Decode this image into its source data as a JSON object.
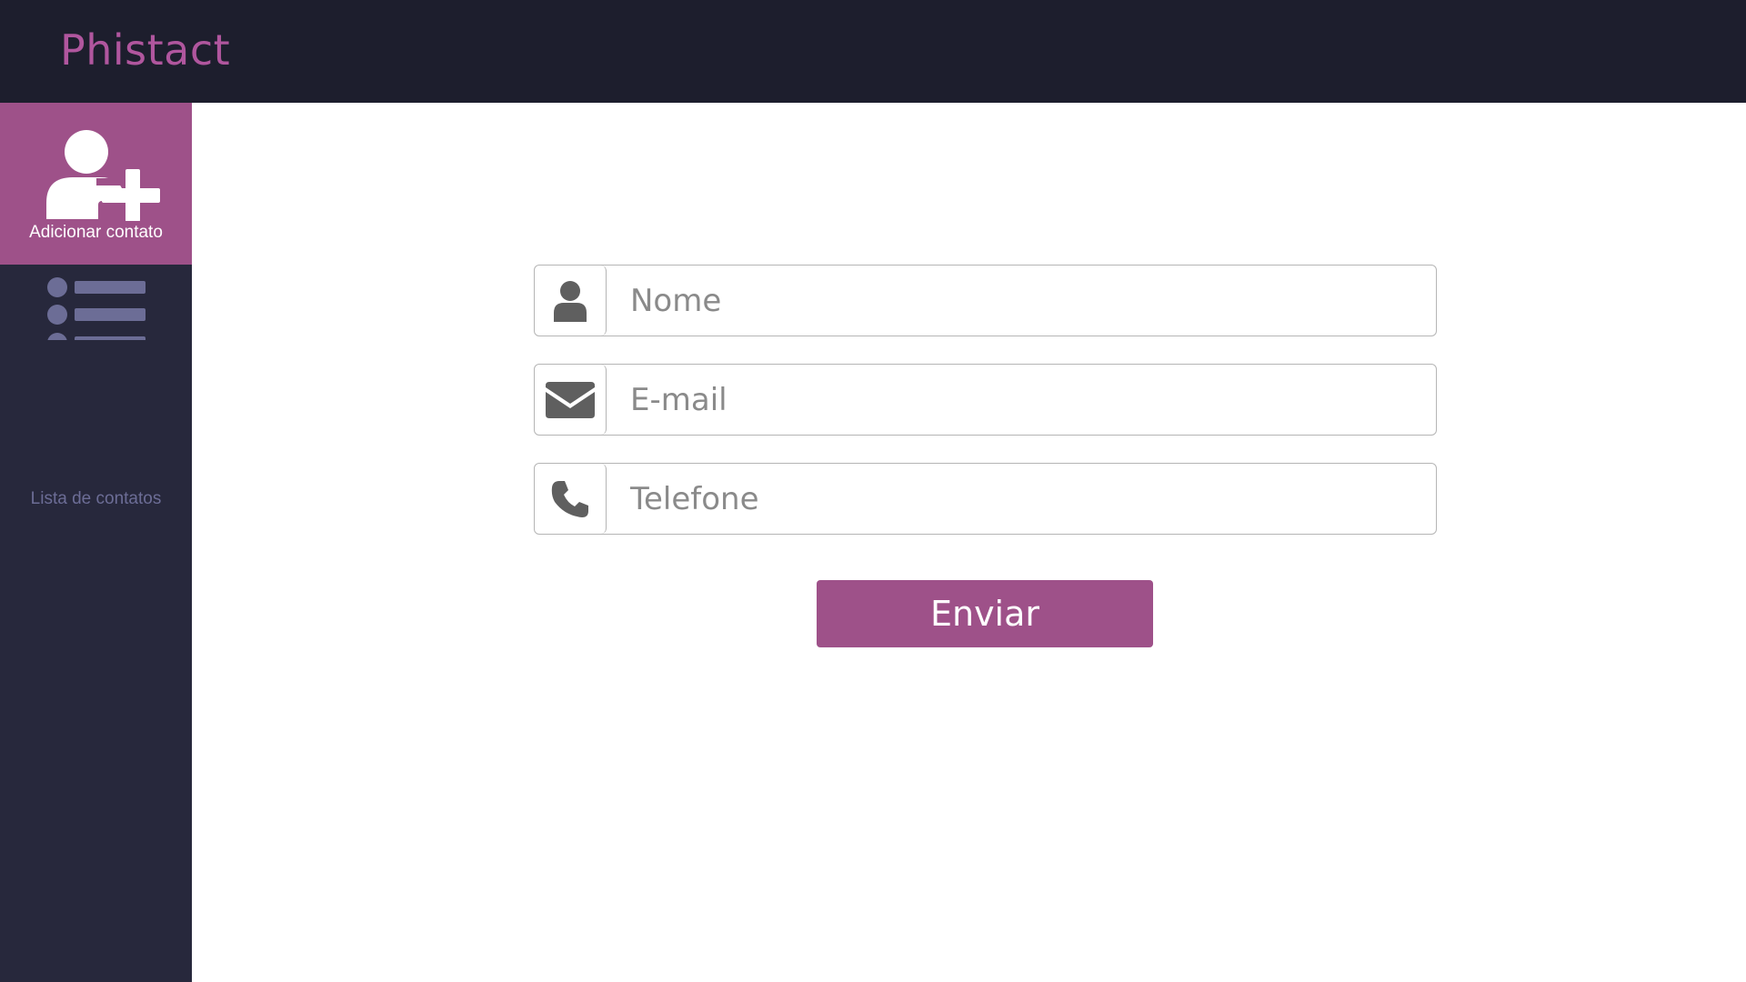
{
  "app": {
    "brand": "Phistact"
  },
  "colors": {
    "brand": "#b0569e",
    "accent": "#9e5189",
    "topbar": "#1d1e2d",
    "sidebar": "#27283c",
    "sidebar_muted": "#6c6d96",
    "field_icon": "#5f5f5f"
  },
  "sidebar": {
    "items": [
      {
        "label": "Adicionar contato",
        "icon": "add-user-icon",
        "active": true
      },
      {
        "label": "Lista de contatos",
        "icon": "list-icon",
        "active": false
      }
    ]
  },
  "form": {
    "fields": [
      {
        "icon": "user-icon",
        "placeholder": "Nome",
        "value": ""
      },
      {
        "icon": "envelope-icon",
        "placeholder": "E-mail",
        "value": ""
      },
      {
        "icon": "phone-icon",
        "placeholder": "Telefone",
        "value": ""
      }
    ],
    "submit_label": "Enviar"
  }
}
